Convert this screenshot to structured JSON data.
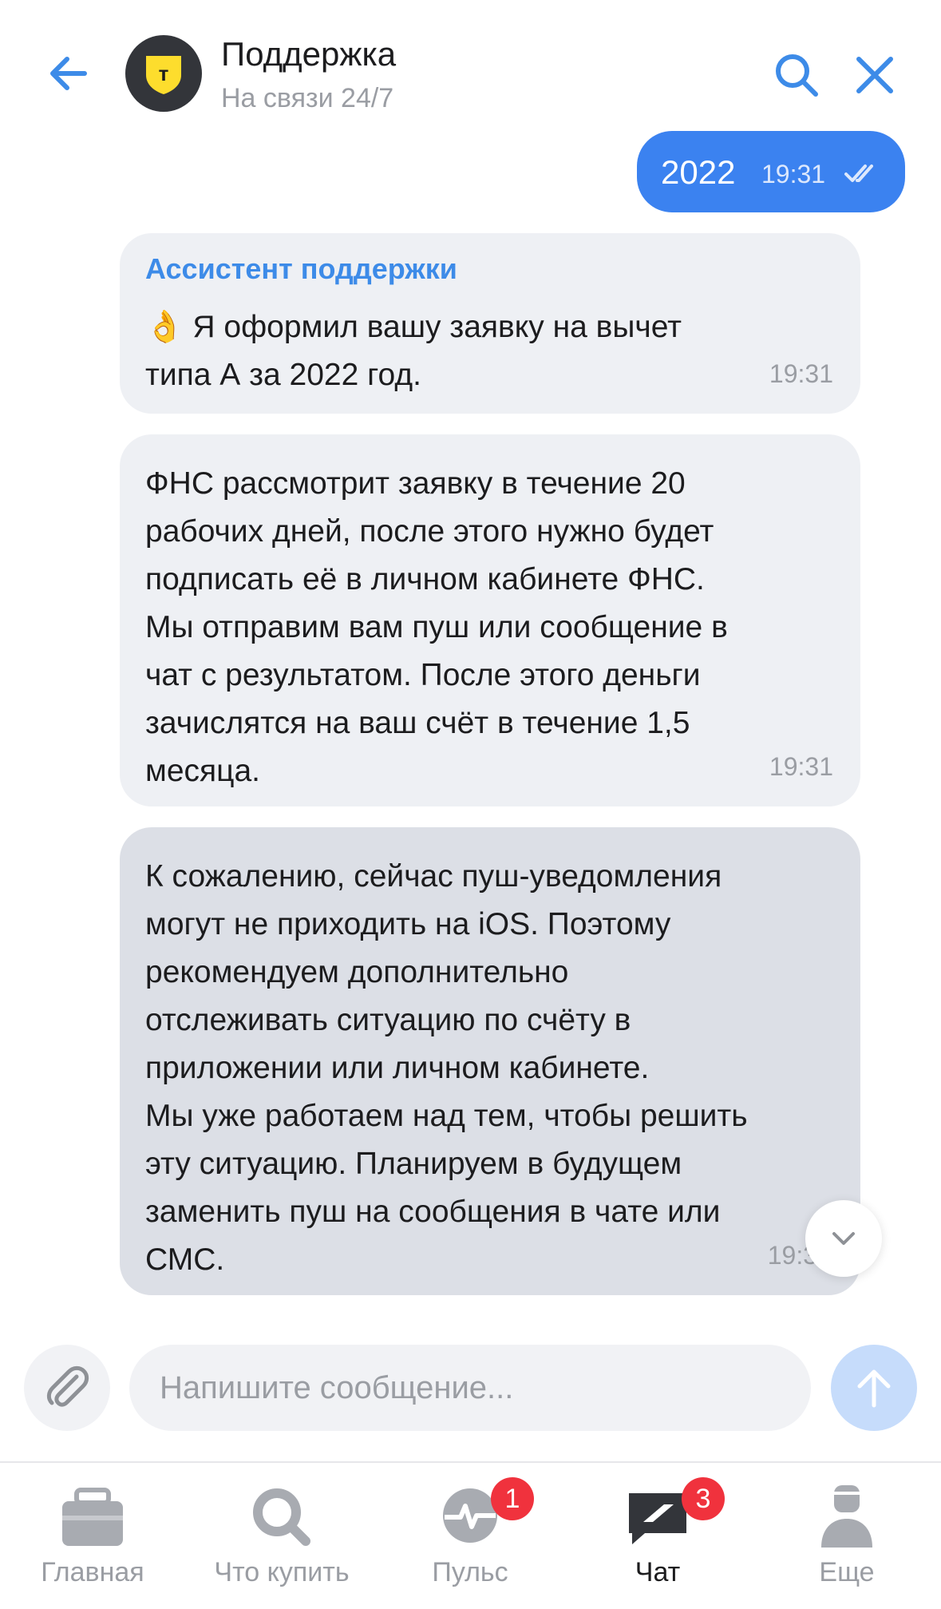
{
  "header": {
    "title": "Поддержка",
    "subtitle": "На связи 24/7",
    "avatar_letter": "т"
  },
  "messages": [
    {
      "direction": "out",
      "text": "2022",
      "time": "19:31",
      "status": "read"
    },
    {
      "direction": "in",
      "sender": "Ассистент поддержки",
      "text": "👌 Я оформил вашу заявку на вычет\nтипа А за 2022 год.",
      "time": "19:31"
    },
    {
      "direction": "in",
      "text": "ФНС рассмотрит заявку в течение 20\nрабочих дней, после этого нужно будет\nподписать её в личном кабинете ФНС.\nМы отправим вам пуш или сообщение в\nчат с результатом. После этого деньги\nзачислятся на ваш счёт в течение 1,5\nмесяца.",
      "time": "19:31"
    },
    {
      "direction": "in",
      "text": "К сожалению, сейчас пуш-уведомления\nмогут не приходить на iOS. Поэтому\nрекомендуем дополнительно\nотслеживать ситуацию по счёту в\nприложении или личном кабинете.\nМы уже работаем над тем, чтобы решить\nэту ситуацию. Планируем в будущем\nзаменить пуш на сообщения в чате или\nСМС.",
      "time": "19:3"
    }
  ],
  "composer": {
    "placeholder": "Напишите сообщение..."
  },
  "tabs": [
    {
      "label": "Главная",
      "icon": "briefcase-icon",
      "badge": null
    },
    {
      "label": "Что купить",
      "icon": "search-icon",
      "badge": null
    },
    {
      "label": "Пульс",
      "icon": "pulse-icon",
      "badge": "1"
    },
    {
      "label": "Чат",
      "icon": "chat-icon",
      "badge": "3",
      "active": true
    },
    {
      "label": "Еще",
      "icon": "profile-icon",
      "badge": null
    }
  ],
  "colors": {
    "accent": "#3b82f0",
    "bubble_in": "#eef0f4",
    "badge": "#f0323d"
  }
}
